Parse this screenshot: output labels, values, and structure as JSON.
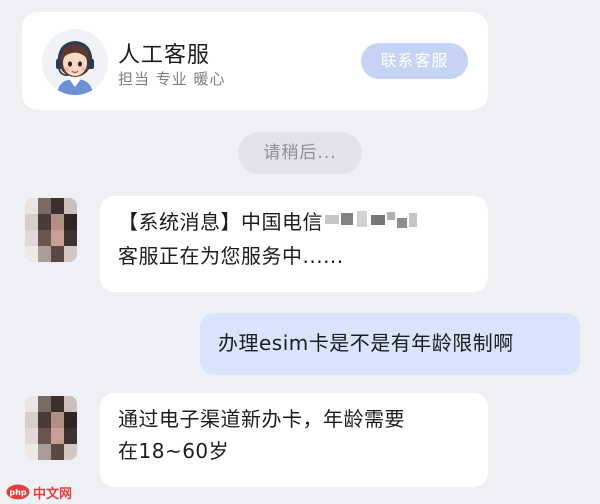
{
  "service_card": {
    "title": "人工客服",
    "tagline": "担当 专业 暖心",
    "contact_button": "联系客服"
  },
  "status": {
    "waiting": "请稍后..."
  },
  "messages": [
    {
      "from": "agent",
      "lines": [
        "【系统消息】中国电信",
        "客服正在为您服务中......"
      ]
    },
    {
      "from": "user",
      "text": "办理esim卡是不是有年龄限制啊"
    },
    {
      "from": "agent",
      "lines": [
        "通过电子渠道新办卡，年龄需要",
        "在18~60岁"
      ]
    }
  ],
  "watermark": {
    "text": "中文网",
    "logo_letters": "php"
  },
  "colors": {
    "background": "#eff0f4",
    "card": "#ffffff",
    "user_bubble": "#d9e3fb",
    "contact_button": "#c7d3f5",
    "wait_pill": "#e2e3e8"
  }
}
